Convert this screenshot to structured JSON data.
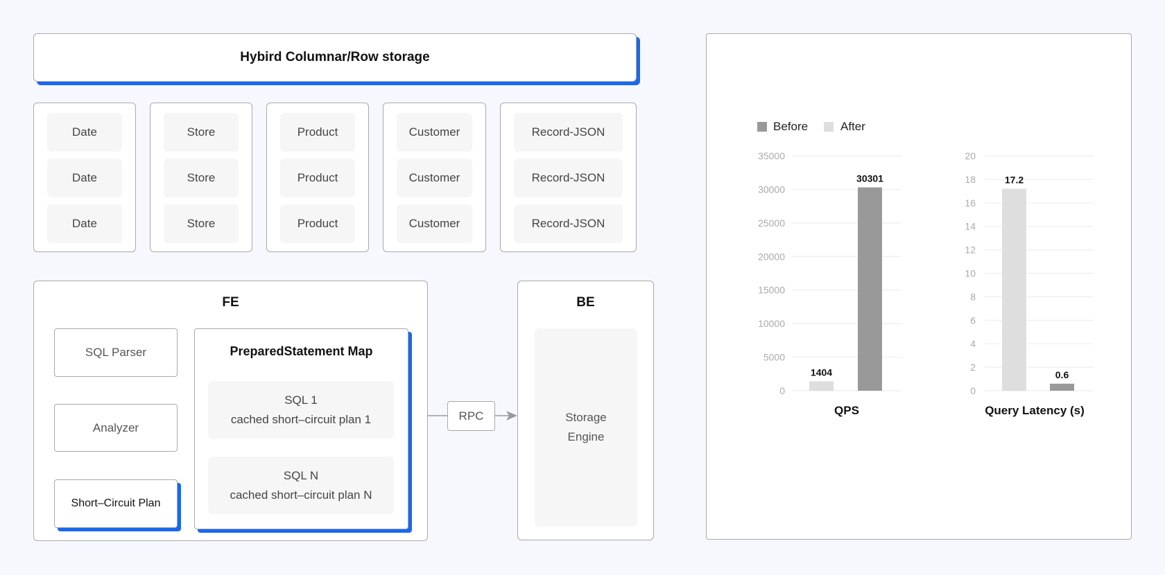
{
  "storage": {
    "title": "Hybird Columnar/Row storage",
    "columns": [
      {
        "name": "date",
        "cells": [
          "Date",
          "Date",
          "Date"
        ]
      },
      {
        "name": "store",
        "cells": [
          "Store",
          "Store",
          "Store"
        ]
      },
      {
        "name": "product",
        "cells": [
          "Product",
          "Product",
          "Product"
        ]
      },
      {
        "name": "customer",
        "cells": [
          "Customer",
          "Customer",
          "Customer"
        ]
      },
      {
        "name": "record-json",
        "cells": [
          "Record-JSON",
          "Record-JSON",
          "Record-JSON"
        ]
      }
    ]
  },
  "fe": {
    "title": "FE",
    "sql_parser": "SQL Parser",
    "analyzer": "Analyzer",
    "short_circuit_plan": "Short–Circuit Plan",
    "prepared_map": {
      "title": "PreparedStatement Map",
      "entries": [
        {
          "sql": "SQL 1",
          "plan": "cached short–circuit plan 1"
        },
        {
          "sql": "SQL N",
          "plan": "cached short–circuit plan N"
        }
      ]
    }
  },
  "rpc": {
    "label": "RPC"
  },
  "be": {
    "title": "BE",
    "storage_engine_line1": "Storage",
    "storage_engine_line2": "Engine"
  },
  "colors": {
    "accent_blue": "#1868f0",
    "before": "#999999",
    "after": "#dedede",
    "background": "#f6f8fd"
  },
  "chart_data": [
    {
      "type": "bar",
      "title": "QPS",
      "xlabel": "QPS",
      "ylabel": "",
      "ylim": [
        0,
        35000
      ],
      "yticks": [
        0,
        5000,
        10000,
        15000,
        20000,
        25000,
        30000,
        35000
      ],
      "grid": true,
      "legend": {
        "position": "top-left",
        "entries": [
          "Before",
          "After"
        ]
      },
      "bars": [
        {
          "series": "After",
          "value": 1404,
          "label": "1404"
        },
        {
          "series": "Before",
          "value": 30301,
          "label": "30301"
        }
      ]
    },
    {
      "type": "bar",
      "title": "Query Latency (s)",
      "xlabel": "Query Latency (s)",
      "ylabel": "",
      "ylim": [
        0,
        20
      ],
      "yticks": [
        0,
        2,
        4,
        6,
        8,
        10,
        12,
        14,
        16,
        18,
        20
      ],
      "grid": true,
      "legend": {
        "position": "top-left",
        "entries": [
          "Before",
          "After"
        ]
      },
      "bars": [
        {
          "series": "After",
          "value": 17.2,
          "label": "17.2"
        },
        {
          "series": "Before",
          "value": 0.6,
          "label": "0.6"
        }
      ]
    }
  ],
  "legend": {
    "before_label": "Before",
    "after_label": "After"
  }
}
